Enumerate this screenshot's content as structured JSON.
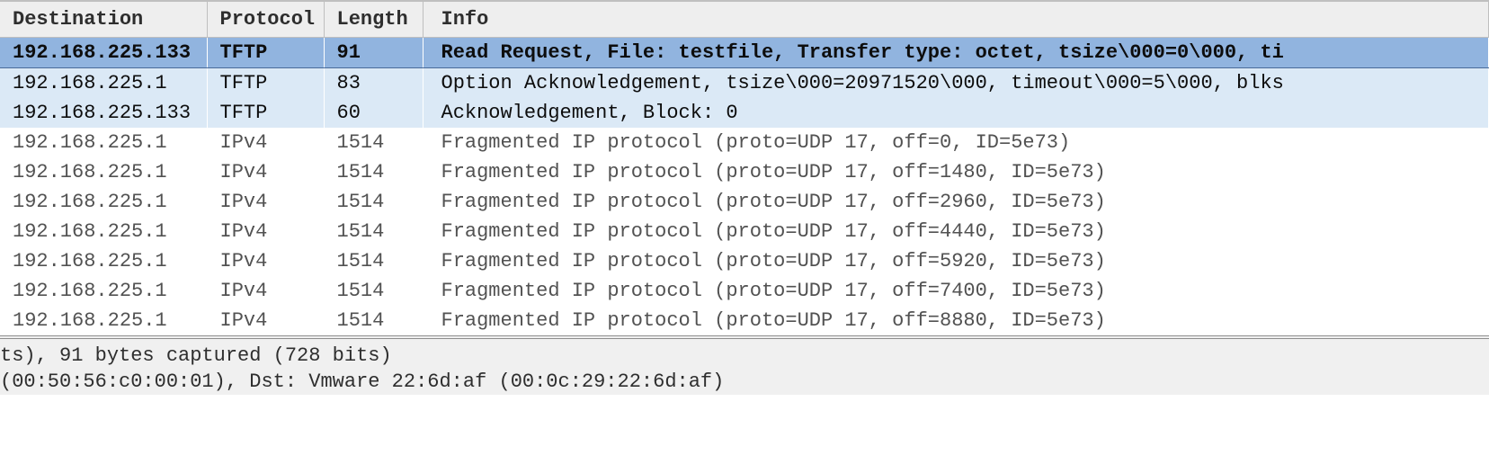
{
  "columns": {
    "destination": "Destination",
    "protocol": "Protocol",
    "length": "Length",
    "info": "Info"
  },
  "rows": [
    {
      "dest": "192.168.225.133",
      "proto": "TFTP",
      "len": "91",
      "info": "Read Request, File: testfile, Transfer type: octet, tsize\\000=0\\000, ti",
      "style": "selected"
    },
    {
      "dest": "192.168.225.1",
      "proto": "TFTP",
      "len": "83",
      "info": "Option Acknowledgement, tsize\\000=20971520\\000, timeout\\000=5\\000, blks",
      "style": "highlight"
    },
    {
      "dest": "192.168.225.133",
      "proto": "TFTP",
      "len": "60",
      "info": "Acknowledgement, Block: 0",
      "style": "highlight"
    },
    {
      "dest": "192.168.225.1",
      "proto": "IPv4",
      "len": "1514",
      "info": "Fragmented IP protocol (proto=UDP 17, off=0, ID=5e73)",
      "style": "normal"
    },
    {
      "dest": "192.168.225.1",
      "proto": "IPv4",
      "len": "1514",
      "info": "Fragmented IP protocol (proto=UDP 17, off=1480, ID=5e73)",
      "style": "normal"
    },
    {
      "dest": "192.168.225.1",
      "proto": "IPv4",
      "len": "1514",
      "info": "Fragmented IP protocol (proto=UDP 17, off=2960, ID=5e73)",
      "style": "normal"
    },
    {
      "dest": "192.168.225.1",
      "proto": "IPv4",
      "len": "1514",
      "info": "Fragmented IP protocol (proto=UDP 17, off=4440, ID=5e73)",
      "style": "normal"
    },
    {
      "dest": "192.168.225.1",
      "proto": "IPv4",
      "len": "1514",
      "info": "Fragmented IP protocol (proto=UDP 17, off=5920, ID=5e73)",
      "style": "normal"
    },
    {
      "dest": "192.168.225.1",
      "proto": "IPv4",
      "len": "1514",
      "info": "Fragmented IP protocol (proto=UDP 17, off=7400, ID=5e73)",
      "style": "normal"
    },
    {
      "dest": "192.168.225.1",
      "proto": "IPv4",
      "len": "1514",
      "info": "Fragmented IP protocol (proto=UDP 17, off=8880, ID=5e73)",
      "style": "normal"
    }
  ],
  "detail": {
    "line1": "ts), 91 bytes captured (728 bits)",
    "line2": "  (00:50:56:c0:00:01), Dst: Vmware 22:6d:af (00:0c:29:22:6d:af)"
  }
}
